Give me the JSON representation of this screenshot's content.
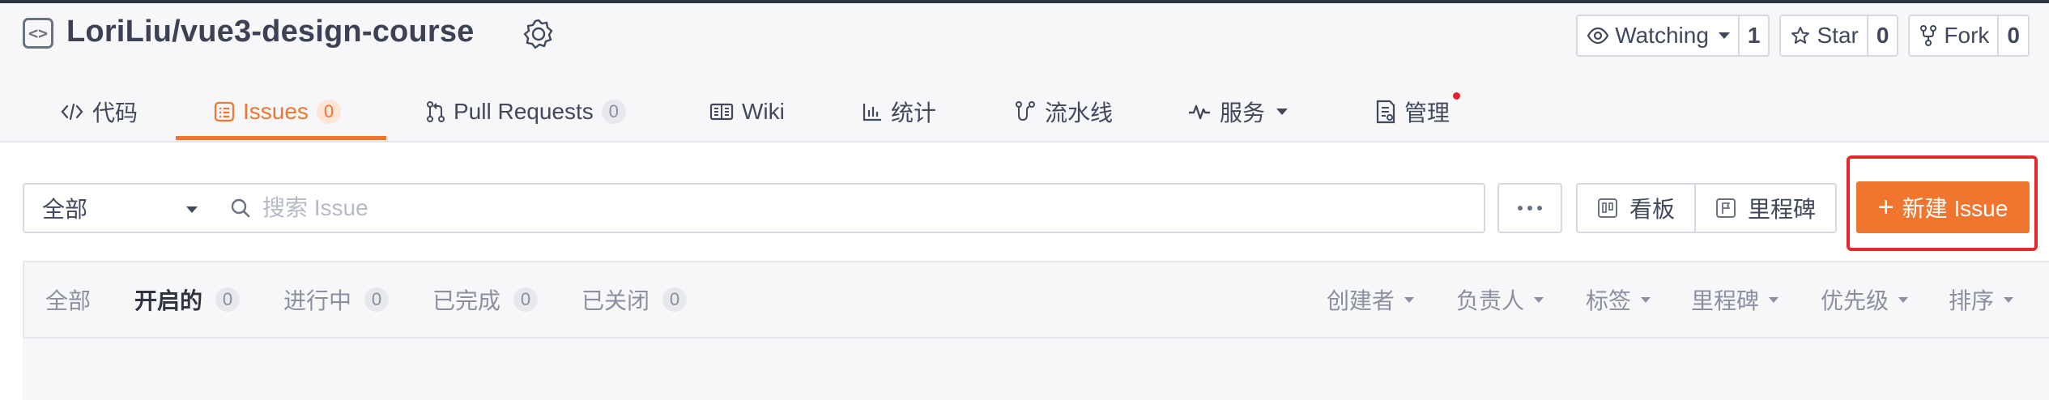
{
  "repo": {
    "full_name": "LoriLiu/vue3-design-course",
    "icons": {
      "repo": "code-repo-icon",
      "badge": "award-badge-icon"
    },
    "actions": [
      {
        "key": "watch",
        "label": "Watching",
        "count": "1",
        "icon": "eye-icon",
        "has_dropdown": true
      },
      {
        "key": "star",
        "label": "Star",
        "count": "0",
        "icon": "star-icon"
      },
      {
        "key": "fork",
        "label": "Fork",
        "count": "0",
        "icon": "fork-icon"
      }
    ]
  },
  "tabs": [
    {
      "label": "代码",
      "icon": "code-icon"
    },
    {
      "label": "Issues",
      "count": "0",
      "icon": "issues-icon",
      "active": true
    },
    {
      "label": "Pull Requests",
      "count": "0",
      "icon": "pull-request-icon"
    },
    {
      "label": "Wiki",
      "icon": "book-icon"
    },
    {
      "label": "统计",
      "icon": "bar-chart-icon"
    },
    {
      "label": "流水线",
      "icon": "pipeline-icon"
    },
    {
      "label": "服务",
      "icon": "pulse-icon",
      "has_dropdown": true
    },
    {
      "label": "管理",
      "icon": "settings-doc-icon",
      "has_notification_dot": true
    }
  ],
  "toolbar": {
    "scope_select": "全部",
    "search_placeholder": "搜索 Issue",
    "board_label": "看板",
    "milestone_label": "里程碑",
    "new_issue_label": "新建 Issue"
  },
  "state_tabs": [
    {
      "label": "全部"
    },
    {
      "label": "开启的",
      "count": "0",
      "active": true
    },
    {
      "label": "进行中",
      "count": "0"
    },
    {
      "label": "已完成",
      "count": "0"
    },
    {
      "label": "已关闭",
      "count": "0"
    }
  ],
  "filters": [
    "创建者",
    "负责人",
    "标签",
    "里程碑",
    "优先级",
    "排序"
  ],
  "colors": {
    "accent": "#f0752e",
    "highlight": "#e8262f"
  }
}
